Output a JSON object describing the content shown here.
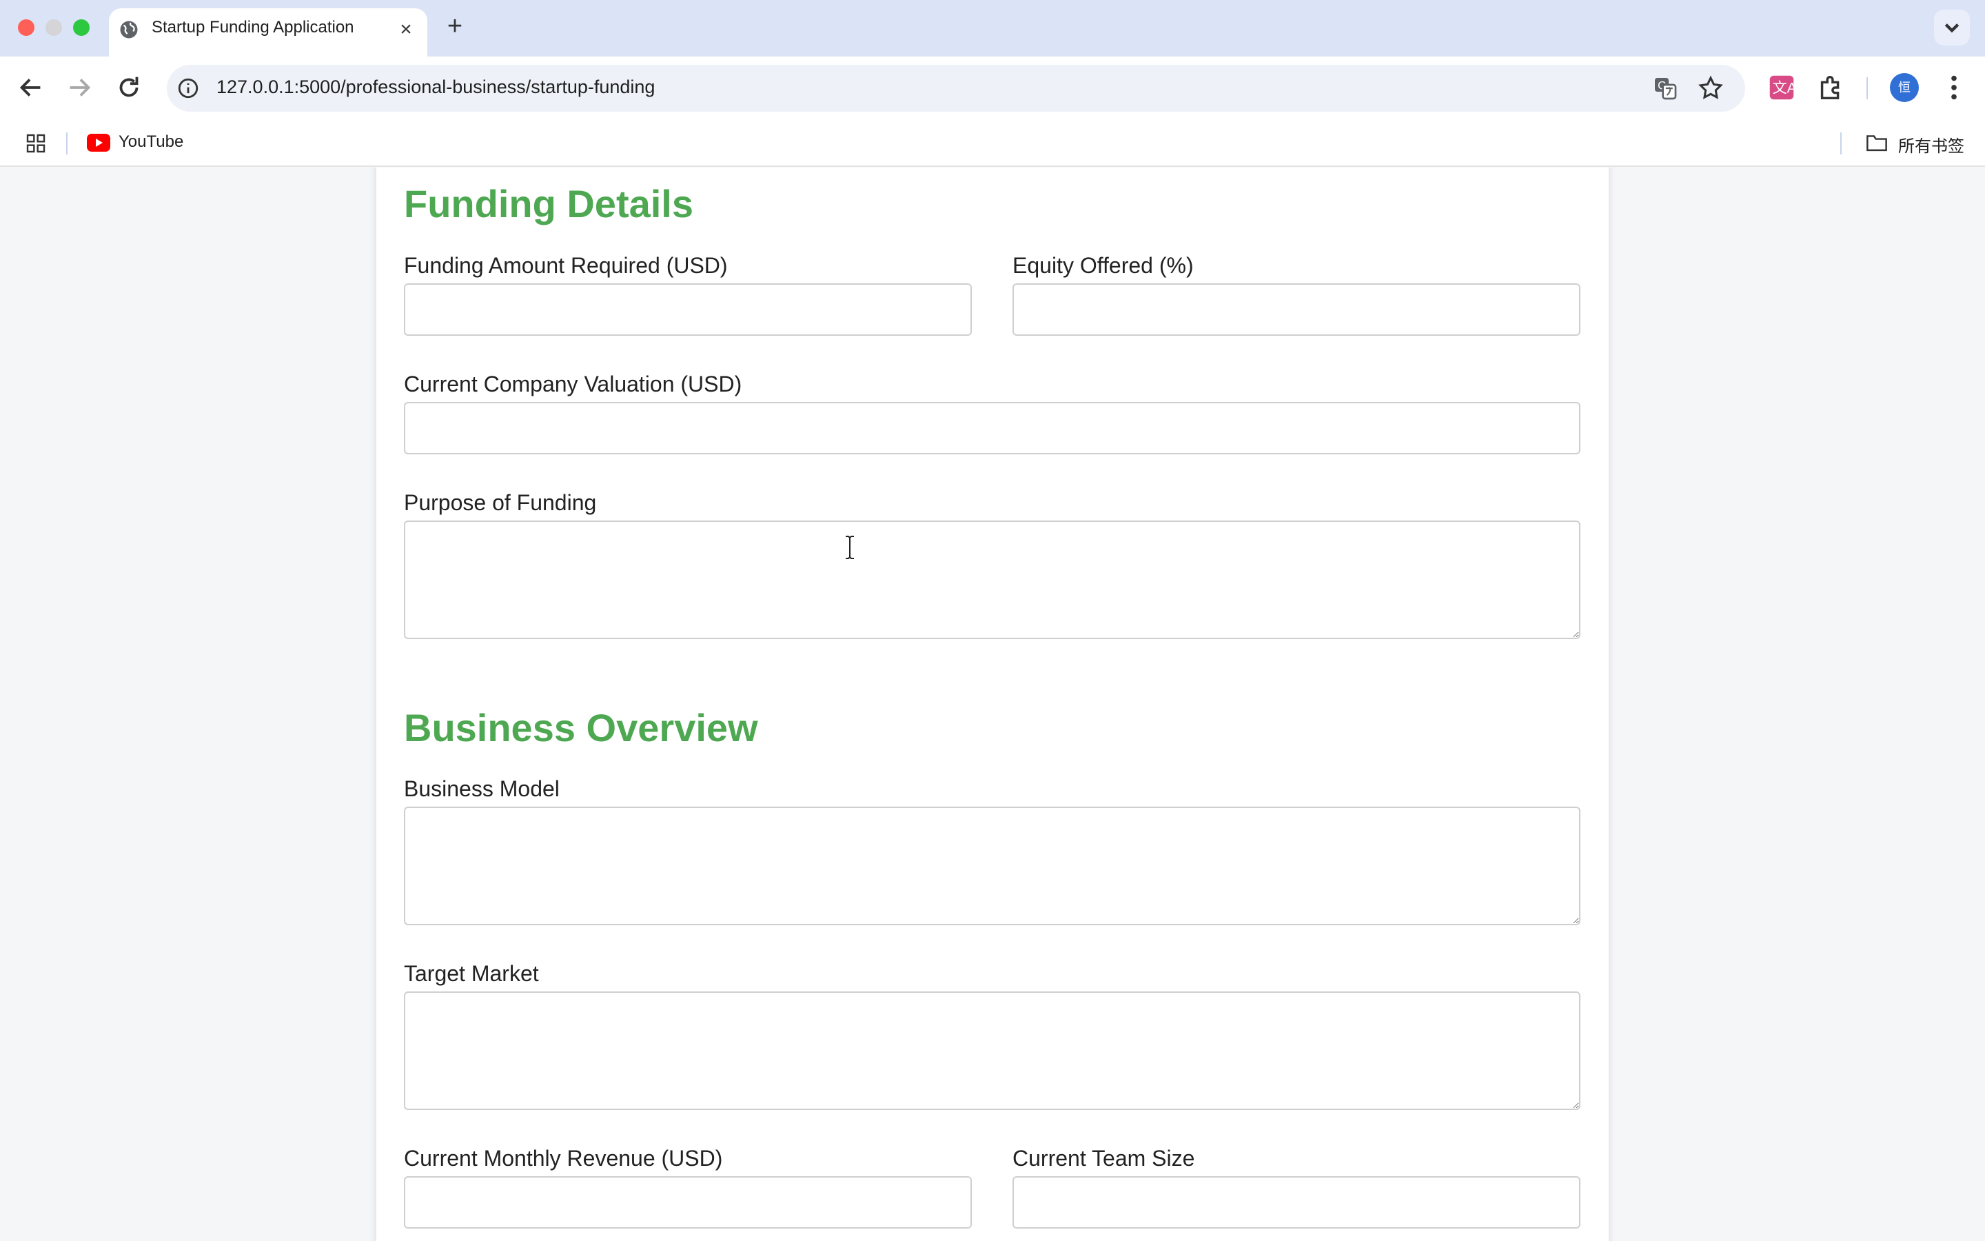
{
  "browser": {
    "tab_title": "Startup Funding Application",
    "url": "127.0.0.1:5000/professional-business/startup-funding",
    "profile_initial": "恒",
    "bookmarks": [
      {
        "label": "YouTube",
        "icon": "youtube-icon"
      }
    ],
    "all_bookmarks_label": "所有书签"
  },
  "form": {
    "funding_section": {
      "title": "Funding Details",
      "funding_amount_label": "Funding Amount Required (USD)",
      "funding_amount_value": "",
      "equity_label": "Equity Offered (%)",
      "equity_value": "",
      "valuation_label": "Current Company Valuation (USD)",
      "valuation_value": "",
      "purpose_label": "Purpose of Funding",
      "purpose_value": ""
    },
    "business_section": {
      "title": "Business Overview",
      "model_label": "Business Model",
      "model_value": "",
      "market_label": "Target Market",
      "market_value": "",
      "revenue_label": "Current Monthly Revenue (USD)",
      "revenue_value": "",
      "team_label": "Current Team Size",
      "team_value": ""
    }
  },
  "colors": {
    "section_heading": "#4ea852",
    "tabbar_bg": "#dbe3f6"
  }
}
